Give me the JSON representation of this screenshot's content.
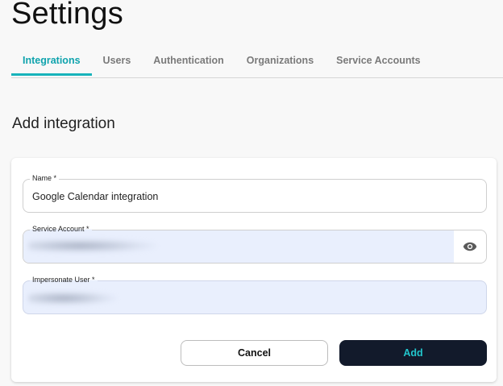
{
  "page": {
    "title": "Settings"
  },
  "tabs": [
    {
      "label": "Integrations",
      "active": true
    },
    {
      "label": "Users",
      "active": false
    },
    {
      "label": "Authentication",
      "active": false
    },
    {
      "label": "Organizations",
      "active": false
    },
    {
      "label": "Service Accounts",
      "active": false
    }
  ],
  "section": {
    "title": "Add integration"
  },
  "form": {
    "name": {
      "label": "Name *",
      "value": "Google Calendar integration"
    },
    "service_account": {
      "label": "Service Account *",
      "value_redacted": true,
      "toggle_icon": "eye-icon"
    },
    "impersonate_user": {
      "label": "Impersonate User *",
      "value_redacted": true
    }
  },
  "actions": {
    "cancel_label": "Cancel",
    "add_label": "Add"
  },
  "colors": {
    "accent": "#17b3bb",
    "filled_field": "#e9effd",
    "primary_button": "#121a2b",
    "primary_button_text": "#22c6cc"
  }
}
